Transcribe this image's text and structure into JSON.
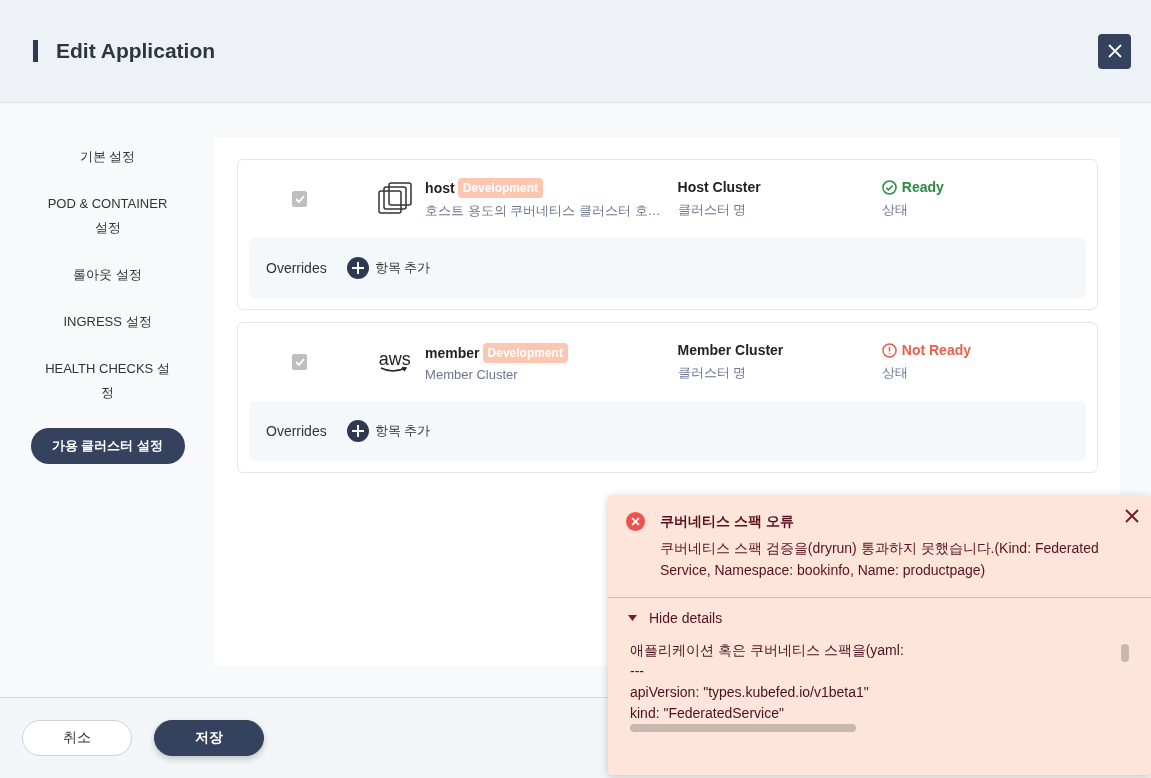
{
  "window": {
    "title": "Edit Application"
  },
  "sidebar": {
    "items": [
      {
        "label": "기본 설정",
        "selected": false
      },
      {
        "label": "POD & CONTAINER 설정",
        "selected": false
      },
      {
        "label": "롤아웃 설정",
        "selected": false
      },
      {
        "label": "INGRESS 설정",
        "selected": false
      },
      {
        "label": "HEALTH CHECKS 설정",
        "selected": false
      },
      {
        "label": "가용 클러스터 설정",
        "selected": true
      }
    ]
  },
  "clusters": [
    {
      "checked": true,
      "logo": {
        "kind": "stack"
      },
      "name": "host",
      "tag": "Development",
      "description": "호스트 용도의 쿠버네티스 클러스터 호…",
      "type": "Host Cluster",
      "type_caption": "클러스터 명",
      "status": "Ready",
      "kind": "ready",
      "status_caption": "상태",
      "overrides_label": "Overrides",
      "add_label": "항목 추가"
    },
    {
      "checked": true,
      "logo": {
        "kind": "wordmark",
        "text": "aws"
      },
      "name": "member",
      "tag": "Development",
      "description": "Member Cluster",
      "type": "Member Cluster",
      "type_caption": "클러스터 명",
      "status": "Not Ready",
      "kind": "not_ready",
      "status_caption": "상태",
      "overrides_label": "Overrides",
      "add_label": "항목 추가"
    }
  ],
  "footer": {
    "buttons": [
      {
        "label": "취소",
        "kind": "secondary"
      },
      {
        "label": "저장",
        "kind": "primary"
      }
    ]
  },
  "toast": {
    "title": "쿠버네티스 스팩 오류",
    "message": "쿠버네티스 스팩 검증을(dryrun) 통과하지 못했습니다.(Kind: Federated Service, Namespace: bookinfo, Name: productpage)",
    "details_toggle": "Hide details",
    "expanded": true,
    "details_lines": [
      "애플리케이션 혹은 쿠버네티스 스팩을(yaml:",
      "---",
      "apiVersion: \"types.kubefed.io/v1beta1\"",
      "kind: \"FederatedService\""
    ]
  }
}
